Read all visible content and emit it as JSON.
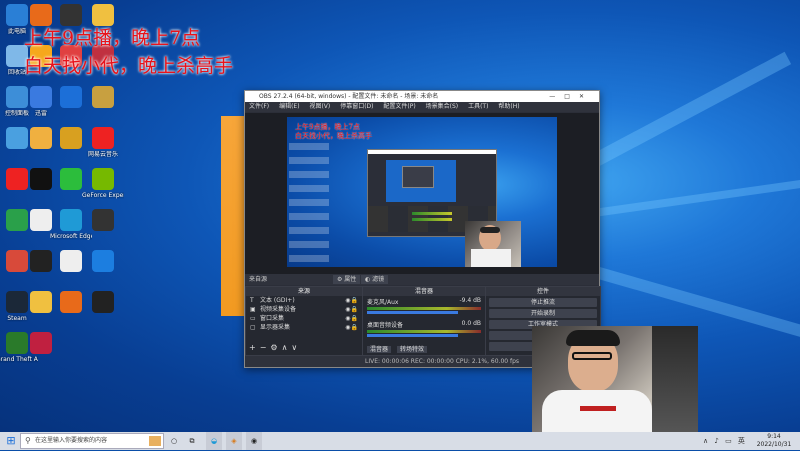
{
  "overlay": {
    "line1": "上午9点播，晚上7点",
    "line2": "白天找小代，晚上杀高手"
  },
  "desktop_icons": [
    {
      "label": "此电脑",
      "icon": "computer-icon",
      "color": "#2a7fd6"
    },
    {
      "label": "",
      "icon": "tool-icon",
      "color": "#e86a1a"
    },
    {
      "label": "",
      "icon": "obs-icon",
      "color": "#333"
    },
    {
      "label": "",
      "icon": "folder-icon",
      "color": "#f0c040"
    },
    {
      "label": "回收站",
      "icon": "recycle-bin-icon",
      "color": "#7fb8e8"
    },
    {
      "label": "",
      "icon": "rockstar-icon",
      "color": "#f6a81c"
    },
    {
      "label": "",
      "icon": "app-icon",
      "color": "#e04040"
    },
    {
      "label": "",
      "icon": "game-icon",
      "color": "#c03040"
    },
    {
      "label": "控制面板",
      "icon": "control-panel-icon",
      "color": "#3d8ed8"
    },
    {
      "label": "迅雷",
      "icon": "thunder-icon",
      "color": "#3a7ae0"
    },
    {
      "label": "",
      "icon": "app-icon",
      "color": "#1c6fd8"
    },
    {
      "label": "",
      "icon": "league-icon",
      "color": "#c8a040"
    },
    {
      "label": "",
      "icon": "network-icon",
      "color": "#4aa0e0"
    },
    {
      "label": "",
      "icon": "pubg-icon",
      "color": "#f0b040"
    },
    {
      "label": "",
      "icon": "teamviewer-icon",
      "color": "#d8a020"
    },
    {
      "label": "网易云音乐",
      "icon": "netease-music-icon",
      "color": "#e22"
    },
    {
      "label": "",
      "icon": "ggpk-icon",
      "color": "#e22"
    },
    {
      "label": "",
      "icon": "qq-icon",
      "color": "#111"
    },
    {
      "label": "",
      "icon": "iqiyi-icon",
      "color": "#2cbd3c"
    },
    {
      "label": "GeForce Experience",
      "icon": "nvidia-icon",
      "color": "#76b900"
    },
    {
      "label": "",
      "icon": "player-icon",
      "color": "#2aa04a"
    },
    {
      "label": "",
      "icon": "doc-icon",
      "color": "#eee"
    },
    {
      "label": "Microsoft Edge",
      "icon": "edge-icon",
      "color": "#1f9ad6"
    },
    {
      "label": "",
      "icon": "video-icon",
      "color": "#333"
    },
    {
      "label": "",
      "icon": "game2-icon",
      "color": "#d84a3a"
    },
    {
      "label": "",
      "icon": "app2-icon",
      "color": "#222"
    },
    {
      "label": "",
      "icon": "doc2-icon",
      "color": "#eee"
    },
    {
      "label": "",
      "icon": "kugou-icon",
      "color": "#1c7ee0"
    },
    {
      "label": "Steam",
      "icon": "steam-icon",
      "color": "#1b2838"
    },
    {
      "label": "",
      "icon": "folder2-icon",
      "color": "#f0c040"
    },
    {
      "label": "",
      "icon": "app3-icon",
      "color": "#e86a1a"
    },
    {
      "label": "",
      "icon": "game3-icon",
      "color": "#222"
    },
    {
      "label": "Grand Theft Auto V",
      "icon": "gta-icon",
      "color": "#2a7a2a"
    },
    {
      "label": "",
      "icon": "app4-icon",
      "color": "#c02040"
    }
  ],
  "obs": {
    "title": "OBS 27.2.4 (64-bit, windows) - 配置文件: 未命名 - 场景: 未命名",
    "menu": [
      "文件(F)",
      "编辑(E)",
      "视图(V)",
      "停靠窗口(D)",
      "配置文件(P)",
      "场景集合(S)",
      "工具(T)",
      "帮助(H)"
    ],
    "toolbar_label": "来自源",
    "properties_label": "属性",
    "filters_label": "滤镜",
    "sources_header": "来源",
    "sources": [
      "文本 (GDI+)",
      "视频采集设备",
      "窗口采集",
      "显示器采集"
    ],
    "mixer_header": "混音器",
    "mixer": [
      {
        "name": "麦克风/Aux",
        "level": "-9.4 dB"
      },
      {
        "name": "桌面音频设备",
        "level": "0.0 dB"
      }
    ],
    "mixer_tabs": [
      "混音器",
      "转场特效"
    ],
    "controls_header": "控件",
    "controls": [
      "停止推流",
      "开始录制",
      "工作室模式",
      "设置",
      "退出"
    ],
    "status": "LIVE: 00:00:06   REC: 00:00:00   CPU: 2.1%, 60.00 fps"
  },
  "taskbar": {
    "search_placeholder": "在这里输入你要搜索的内容",
    "time": "9:14",
    "date": "2022/10/31"
  }
}
